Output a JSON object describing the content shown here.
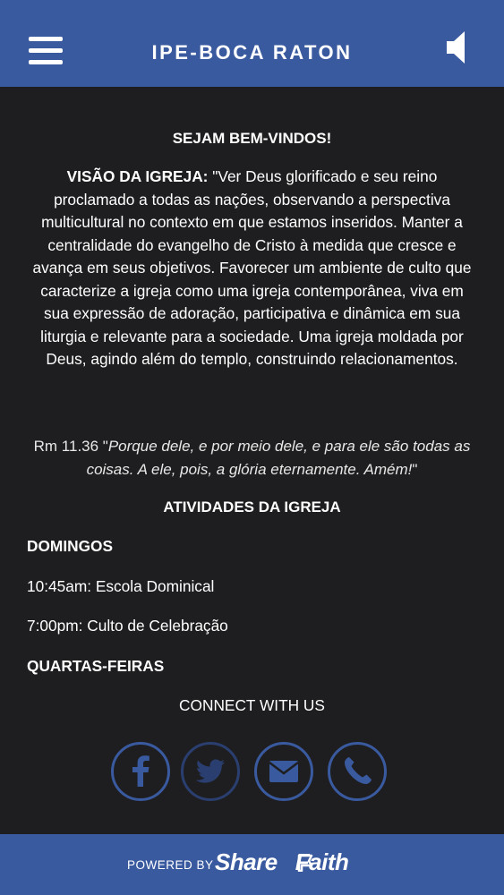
{
  "header": {
    "title": "IPE-BOCA RATON",
    "menu_icon": "hamburger-menu-icon",
    "sound_icon": "speaker-icon"
  },
  "content": {
    "welcome": "SEJAM BEM-VINDOS!",
    "vision_label": "VISÃO DA IGREJA:",
    "vision_text": " \"Ver Deus glorificado e seu reino proclamado a todas as nações, observando a perspectiva multicultural no contexto em que estamos inseridos. Manter a centralidade do evangelho de Cristo à medida que cresce e avança em seus objetivos. Favorecer um ambiente de culto que caracterize a igreja como uma igreja contemporânea, viva em sua expressão de adoração, participativa e dinâmica em sua liturgia e relevante para a sociedade.  Uma igreja moldada por Deus, agindo além do templo, construindo relacionamentos.",
    "verse_ref": "Rm 11.36 \"",
    "verse_text": "Porque dele, e por meio dele, e para ele são todas as coisas. A ele, pois, a glória eternamente. Amém!",
    "verse_close": "\"",
    "activities_title": "ATIVIDADES DA IGREJA",
    "sunday_title": "DOMINGOS",
    "sunday_items": [
      "10:45am: Escola Dominical",
      "7:00pm: Culto de Celebração"
    ],
    "wednesday_title": "QUARTAS-FEIRAS",
    "connect": "CONNECT WITH US"
  },
  "social": {
    "icons": [
      "facebook-icon",
      "twitter-icon",
      "email-icon",
      "phone-icon"
    ],
    "color": "#3a5aa0",
    "twitter_color": "#2a3f70"
  },
  "footer": {
    "powered": "POWERED BY",
    "brand": "Share",
    "brand_end": "Faith"
  },
  "colors": {
    "header_bg": "#3a5aa0",
    "body_bg": "#1e1e20",
    "text": "#ffffff"
  }
}
